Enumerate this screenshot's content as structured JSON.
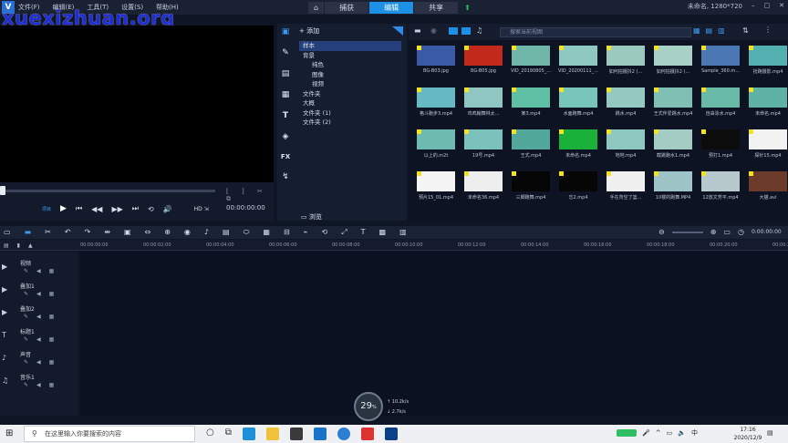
{
  "app": {
    "menu": [
      "文件(F)",
      "编辑(E)",
      "工具(T)",
      "设置(S)",
      "帮助(H)"
    ],
    "tabs": {
      "capture": "捕获",
      "edit": "编辑",
      "share": "共享"
    },
    "window_info": "未命名, 1280*720",
    "watermark": "xuexizhuan.org",
    "accent": "#1e90e6"
  },
  "player": {
    "timecode": "00:00:00:00",
    "project_label": "项目",
    "clip_label": "素材"
  },
  "library": {
    "add_label": "添加",
    "tree": [
      {
        "label": "样本",
        "level": 1,
        "selected": true
      },
      {
        "label": "背景",
        "level": 1,
        "expand": "▲"
      },
      {
        "label": "纯色",
        "level": 2
      },
      {
        "label": "图像",
        "level": 2
      },
      {
        "label": "视频",
        "level": 2
      },
      {
        "label": "文件夹",
        "level": 1
      },
      {
        "label": "大概",
        "level": 1
      },
      {
        "label": "文件夹 (1)",
        "level": 1
      },
      {
        "label": "文件夹 (2)",
        "level": 1
      }
    ],
    "browse_label": "浏览",
    "search_placeholder": "搜索当前视图"
  },
  "media": [
    {
      "label": "BG-B03.jpg",
      "color": "#3a5aa6"
    },
    {
      "label": "BG-B05.jpg",
      "color": "#c42a1c"
    },
    {
      "label": "VID_20190805_...",
      "color": "#6fb5a8"
    },
    {
      "label": "VID_20200111_...",
      "color": "#8fc8c0"
    },
    {
      "label": "如何拍摄抖2 (...",
      "color": "#9cc9bd"
    },
    {
      "label": "如何拍摄抖2 (...",
      "color": "#a9d2c6"
    },
    {
      "label": "Sample_360.m...",
      "color": "#4b78b2"
    },
    {
      "label": "抢跑摄影.mp4",
      "color": "#52b0b0"
    },
    {
      "label": "格斗跑步3.mp4",
      "color": "#66b8c2"
    },
    {
      "label": "鸡鸣翰舞林太...",
      "color": "#8fc6c2"
    },
    {
      "label": "某3.mp4",
      "color": "#5fbfa4"
    },
    {
      "label": "水面跑舞.mp4",
      "color": "#78c5b9"
    },
    {
      "label": "跳水.mp4",
      "color": "#93c9c1"
    },
    {
      "label": "王式伴爱跳水.mp4",
      "color": "#7fbfb4"
    },
    {
      "label": "自由泳水.mp4",
      "color": "#69b9a7"
    },
    {
      "label": "未命名.mp4",
      "color": "#5fb3a5"
    },
    {
      "label": "以上的.m2t",
      "color": "#6cbab0"
    },
    {
      "label": "19号.mp4",
      "color": "#7cc2bc"
    },
    {
      "label": "王式.mp4",
      "color": "#52a89a"
    },
    {
      "label": "未命名.mp4",
      "color": "#19b13a"
    },
    {
      "label": "地地.mp4",
      "color": "#8ec6c0"
    },
    {
      "label": "截跳跑水1.mp4",
      "color": "#a3cdc4"
    },
    {
      "label": "预打1.mp4",
      "color": "#0c0c0c"
    },
    {
      "label": "探针15.mp4",
      "color": "#f2f2f2"
    },
    {
      "label": "预片15_01.mp4",
      "color": "#f4f4f4"
    },
    {
      "label": "未命名36.mp4",
      "color": "#eeeeee"
    },
    {
      "label": "三脚跑舞.mp4",
      "color": "#050505"
    },
    {
      "label": "忘2.mp4",
      "color": "#060606"
    },
    {
      "label": "手在背空了篮...",
      "color": "#f0f0f0"
    },
    {
      "label": "10楼的跑舞.MP4",
      "color": "#9fc4c8"
    },
    {
      "label": "12放文芳平.mp4",
      "color": "#b7c9cc"
    },
    {
      "label": "大猫.avi",
      "color": "#6b3a2a"
    }
  ],
  "timeline": {
    "ticks": [
      "00:00:00:00",
      "00:00:02:00",
      "00:00:04:00",
      "00:00:06:00",
      "00:00:08:00",
      "00:00:10:00",
      "00:00:12:00",
      "00:00:14:00",
      "00:00:16:00",
      "00:00:18:00",
      "00:00:20:00",
      "00:00:2"
    ],
    "end_time": "0:00:00:00",
    "tracks": [
      {
        "label": "视频",
        "icon": "▶"
      },
      {
        "label": "叠加1",
        "icon": "▶"
      },
      {
        "label": "叠加2",
        "icon": "▶"
      },
      {
        "label": "标题1",
        "icon": "T"
      },
      {
        "label": "声音",
        "icon": "♪"
      },
      {
        "label": "音乐1",
        "icon": "♫"
      }
    ]
  },
  "overlay": {
    "gauge_value": "29",
    "gauge_unit": "%",
    "up": "↑ 10.2k/s",
    "down": "↓ 2.7k/s"
  },
  "taskbar": {
    "search_placeholder": "在这里输入你要搜索的内容",
    "time": "17:16",
    "date": "2020/12/9",
    "ime": "中"
  }
}
